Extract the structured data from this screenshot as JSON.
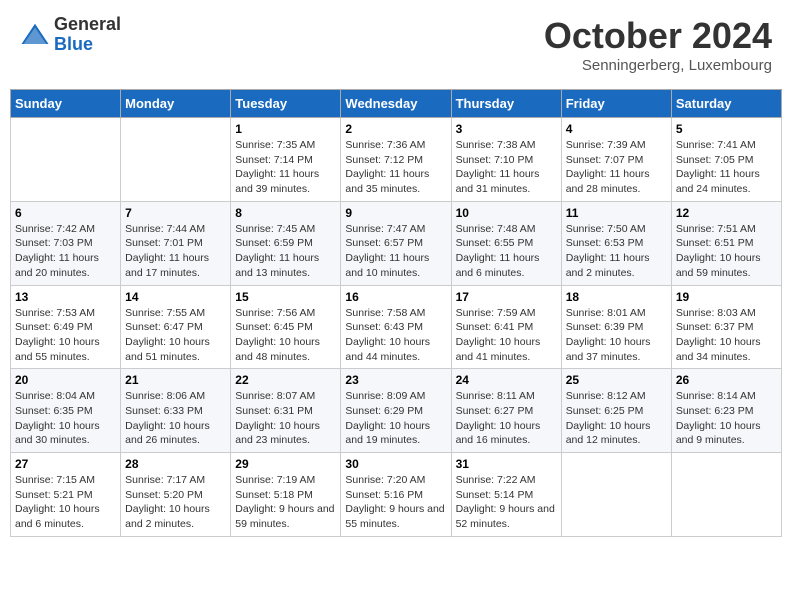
{
  "header": {
    "logo_general": "General",
    "logo_blue": "Blue",
    "month_title": "October 2024",
    "subtitle": "Senningerberg, Luxembourg"
  },
  "days_of_week": [
    "Sunday",
    "Monday",
    "Tuesday",
    "Wednesday",
    "Thursday",
    "Friday",
    "Saturday"
  ],
  "weeks": [
    [
      {
        "day": "",
        "sunrise": "",
        "sunset": "",
        "daylight": ""
      },
      {
        "day": "",
        "sunrise": "",
        "sunset": "",
        "daylight": ""
      },
      {
        "day": "1",
        "sunrise": "Sunrise: 7:35 AM",
        "sunset": "Sunset: 7:14 PM",
        "daylight": "Daylight: 11 hours and 39 minutes."
      },
      {
        "day": "2",
        "sunrise": "Sunrise: 7:36 AM",
        "sunset": "Sunset: 7:12 PM",
        "daylight": "Daylight: 11 hours and 35 minutes."
      },
      {
        "day": "3",
        "sunrise": "Sunrise: 7:38 AM",
        "sunset": "Sunset: 7:10 PM",
        "daylight": "Daylight: 11 hours and 31 minutes."
      },
      {
        "day": "4",
        "sunrise": "Sunrise: 7:39 AM",
        "sunset": "Sunset: 7:07 PM",
        "daylight": "Daylight: 11 hours and 28 minutes."
      },
      {
        "day": "5",
        "sunrise": "Sunrise: 7:41 AM",
        "sunset": "Sunset: 7:05 PM",
        "daylight": "Daylight: 11 hours and 24 minutes."
      }
    ],
    [
      {
        "day": "6",
        "sunrise": "Sunrise: 7:42 AM",
        "sunset": "Sunset: 7:03 PM",
        "daylight": "Daylight: 11 hours and 20 minutes."
      },
      {
        "day": "7",
        "sunrise": "Sunrise: 7:44 AM",
        "sunset": "Sunset: 7:01 PM",
        "daylight": "Daylight: 11 hours and 17 minutes."
      },
      {
        "day": "8",
        "sunrise": "Sunrise: 7:45 AM",
        "sunset": "Sunset: 6:59 PM",
        "daylight": "Daylight: 11 hours and 13 minutes."
      },
      {
        "day": "9",
        "sunrise": "Sunrise: 7:47 AM",
        "sunset": "Sunset: 6:57 PM",
        "daylight": "Daylight: 11 hours and 10 minutes."
      },
      {
        "day": "10",
        "sunrise": "Sunrise: 7:48 AM",
        "sunset": "Sunset: 6:55 PM",
        "daylight": "Daylight: 11 hours and 6 minutes."
      },
      {
        "day": "11",
        "sunrise": "Sunrise: 7:50 AM",
        "sunset": "Sunset: 6:53 PM",
        "daylight": "Daylight: 11 hours and 2 minutes."
      },
      {
        "day": "12",
        "sunrise": "Sunrise: 7:51 AM",
        "sunset": "Sunset: 6:51 PM",
        "daylight": "Daylight: 10 hours and 59 minutes."
      }
    ],
    [
      {
        "day": "13",
        "sunrise": "Sunrise: 7:53 AM",
        "sunset": "Sunset: 6:49 PM",
        "daylight": "Daylight: 10 hours and 55 minutes."
      },
      {
        "day": "14",
        "sunrise": "Sunrise: 7:55 AM",
        "sunset": "Sunset: 6:47 PM",
        "daylight": "Daylight: 10 hours and 51 minutes."
      },
      {
        "day": "15",
        "sunrise": "Sunrise: 7:56 AM",
        "sunset": "Sunset: 6:45 PM",
        "daylight": "Daylight: 10 hours and 48 minutes."
      },
      {
        "day": "16",
        "sunrise": "Sunrise: 7:58 AM",
        "sunset": "Sunset: 6:43 PM",
        "daylight": "Daylight: 10 hours and 44 minutes."
      },
      {
        "day": "17",
        "sunrise": "Sunrise: 7:59 AM",
        "sunset": "Sunset: 6:41 PM",
        "daylight": "Daylight: 10 hours and 41 minutes."
      },
      {
        "day": "18",
        "sunrise": "Sunrise: 8:01 AM",
        "sunset": "Sunset: 6:39 PM",
        "daylight": "Daylight: 10 hours and 37 minutes."
      },
      {
        "day": "19",
        "sunrise": "Sunrise: 8:03 AM",
        "sunset": "Sunset: 6:37 PM",
        "daylight": "Daylight: 10 hours and 34 minutes."
      }
    ],
    [
      {
        "day": "20",
        "sunrise": "Sunrise: 8:04 AM",
        "sunset": "Sunset: 6:35 PM",
        "daylight": "Daylight: 10 hours and 30 minutes."
      },
      {
        "day": "21",
        "sunrise": "Sunrise: 8:06 AM",
        "sunset": "Sunset: 6:33 PM",
        "daylight": "Daylight: 10 hours and 26 minutes."
      },
      {
        "day": "22",
        "sunrise": "Sunrise: 8:07 AM",
        "sunset": "Sunset: 6:31 PM",
        "daylight": "Daylight: 10 hours and 23 minutes."
      },
      {
        "day": "23",
        "sunrise": "Sunrise: 8:09 AM",
        "sunset": "Sunset: 6:29 PM",
        "daylight": "Daylight: 10 hours and 19 minutes."
      },
      {
        "day": "24",
        "sunrise": "Sunrise: 8:11 AM",
        "sunset": "Sunset: 6:27 PM",
        "daylight": "Daylight: 10 hours and 16 minutes."
      },
      {
        "day": "25",
        "sunrise": "Sunrise: 8:12 AM",
        "sunset": "Sunset: 6:25 PM",
        "daylight": "Daylight: 10 hours and 12 minutes."
      },
      {
        "day": "26",
        "sunrise": "Sunrise: 8:14 AM",
        "sunset": "Sunset: 6:23 PM",
        "daylight": "Daylight: 10 hours and 9 minutes."
      }
    ],
    [
      {
        "day": "27",
        "sunrise": "Sunrise: 7:15 AM",
        "sunset": "Sunset: 5:21 PM",
        "daylight": "Daylight: 10 hours and 6 minutes."
      },
      {
        "day": "28",
        "sunrise": "Sunrise: 7:17 AM",
        "sunset": "Sunset: 5:20 PM",
        "daylight": "Daylight: 10 hours and 2 minutes."
      },
      {
        "day": "29",
        "sunrise": "Sunrise: 7:19 AM",
        "sunset": "Sunset: 5:18 PM",
        "daylight": "Daylight: 9 hours and 59 minutes."
      },
      {
        "day": "30",
        "sunrise": "Sunrise: 7:20 AM",
        "sunset": "Sunset: 5:16 PM",
        "daylight": "Daylight: 9 hours and 55 minutes."
      },
      {
        "day": "31",
        "sunrise": "Sunrise: 7:22 AM",
        "sunset": "Sunset: 5:14 PM",
        "daylight": "Daylight: 9 hours and 52 minutes."
      },
      {
        "day": "",
        "sunrise": "",
        "sunset": "",
        "daylight": ""
      },
      {
        "day": "",
        "sunrise": "",
        "sunset": "",
        "daylight": ""
      }
    ]
  ]
}
